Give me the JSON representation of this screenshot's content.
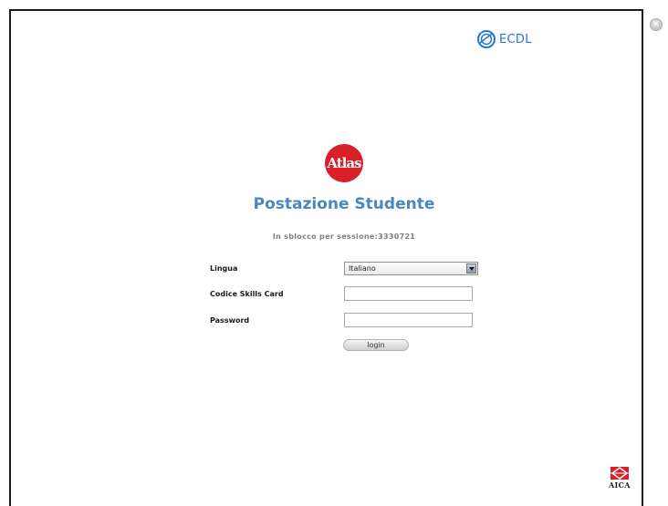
{
  "header": {
    "ecdl_label": "ECDL",
    "close_symbol": "✕"
  },
  "brand": {
    "atlas_logo_text": "Atlas",
    "accent_red": "#d8202a",
    "title_blue": "#4a86c2",
    "ecdl_blue": "#2a77c8"
  },
  "main": {
    "title": "Postazione Studente",
    "session_text": "In sblocco per sessione:3330721"
  },
  "form": {
    "language_label": "Lingua",
    "language_value": "Italiano",
    "skills_card_label": "Codice Skills Card",
    "skills_card_value": "",
    "password_label": "Password",
    "password_value": "",
    "login_label": "login"
  },
  "footer": {
    "aica_label": "AICA"
  }
}
